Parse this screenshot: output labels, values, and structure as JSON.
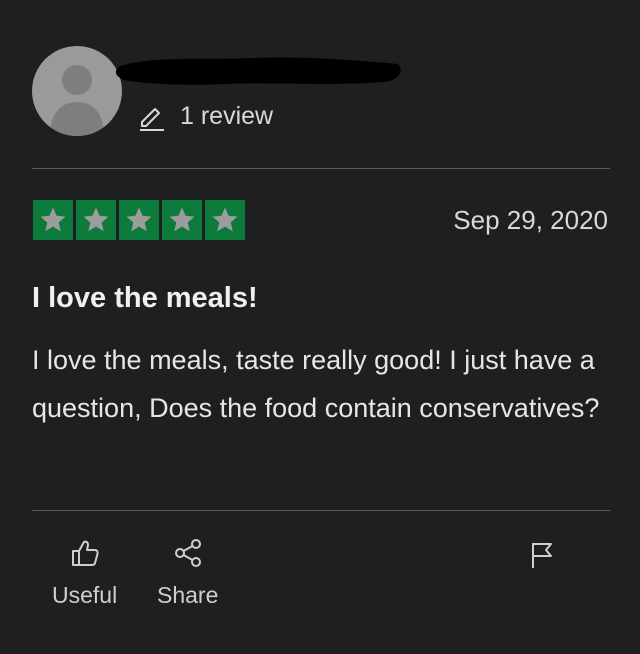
{
  "reviewer": {
    "review_count": "1 review"
  },
  "review": {
    "rating": 5,
    "rating_max": 5,
    "date": "Sep 29, 2020",
    "title": "I love the meals!",
    "body": "I love the meals, taste really good! I just have a question, Does the food contain conservatives?"
  },
  "actions": {
    "useful_label": "Useful",
    "share_label": "Share"
  },
  "colors": {
    "background": "#1f1f21",
    "star_box": "#0b7a3a",
    "star_fill": "#9c9c9c",
    "text": "#e6e6e6"
  },
  "icons": {
    "pencil": "pencil-icon",
    "thumbs_up": "thumbs-up-icon",
    "share": "share-icon",
    "flag": "flag-icon",
    "star": "star-icon"
  }
}
